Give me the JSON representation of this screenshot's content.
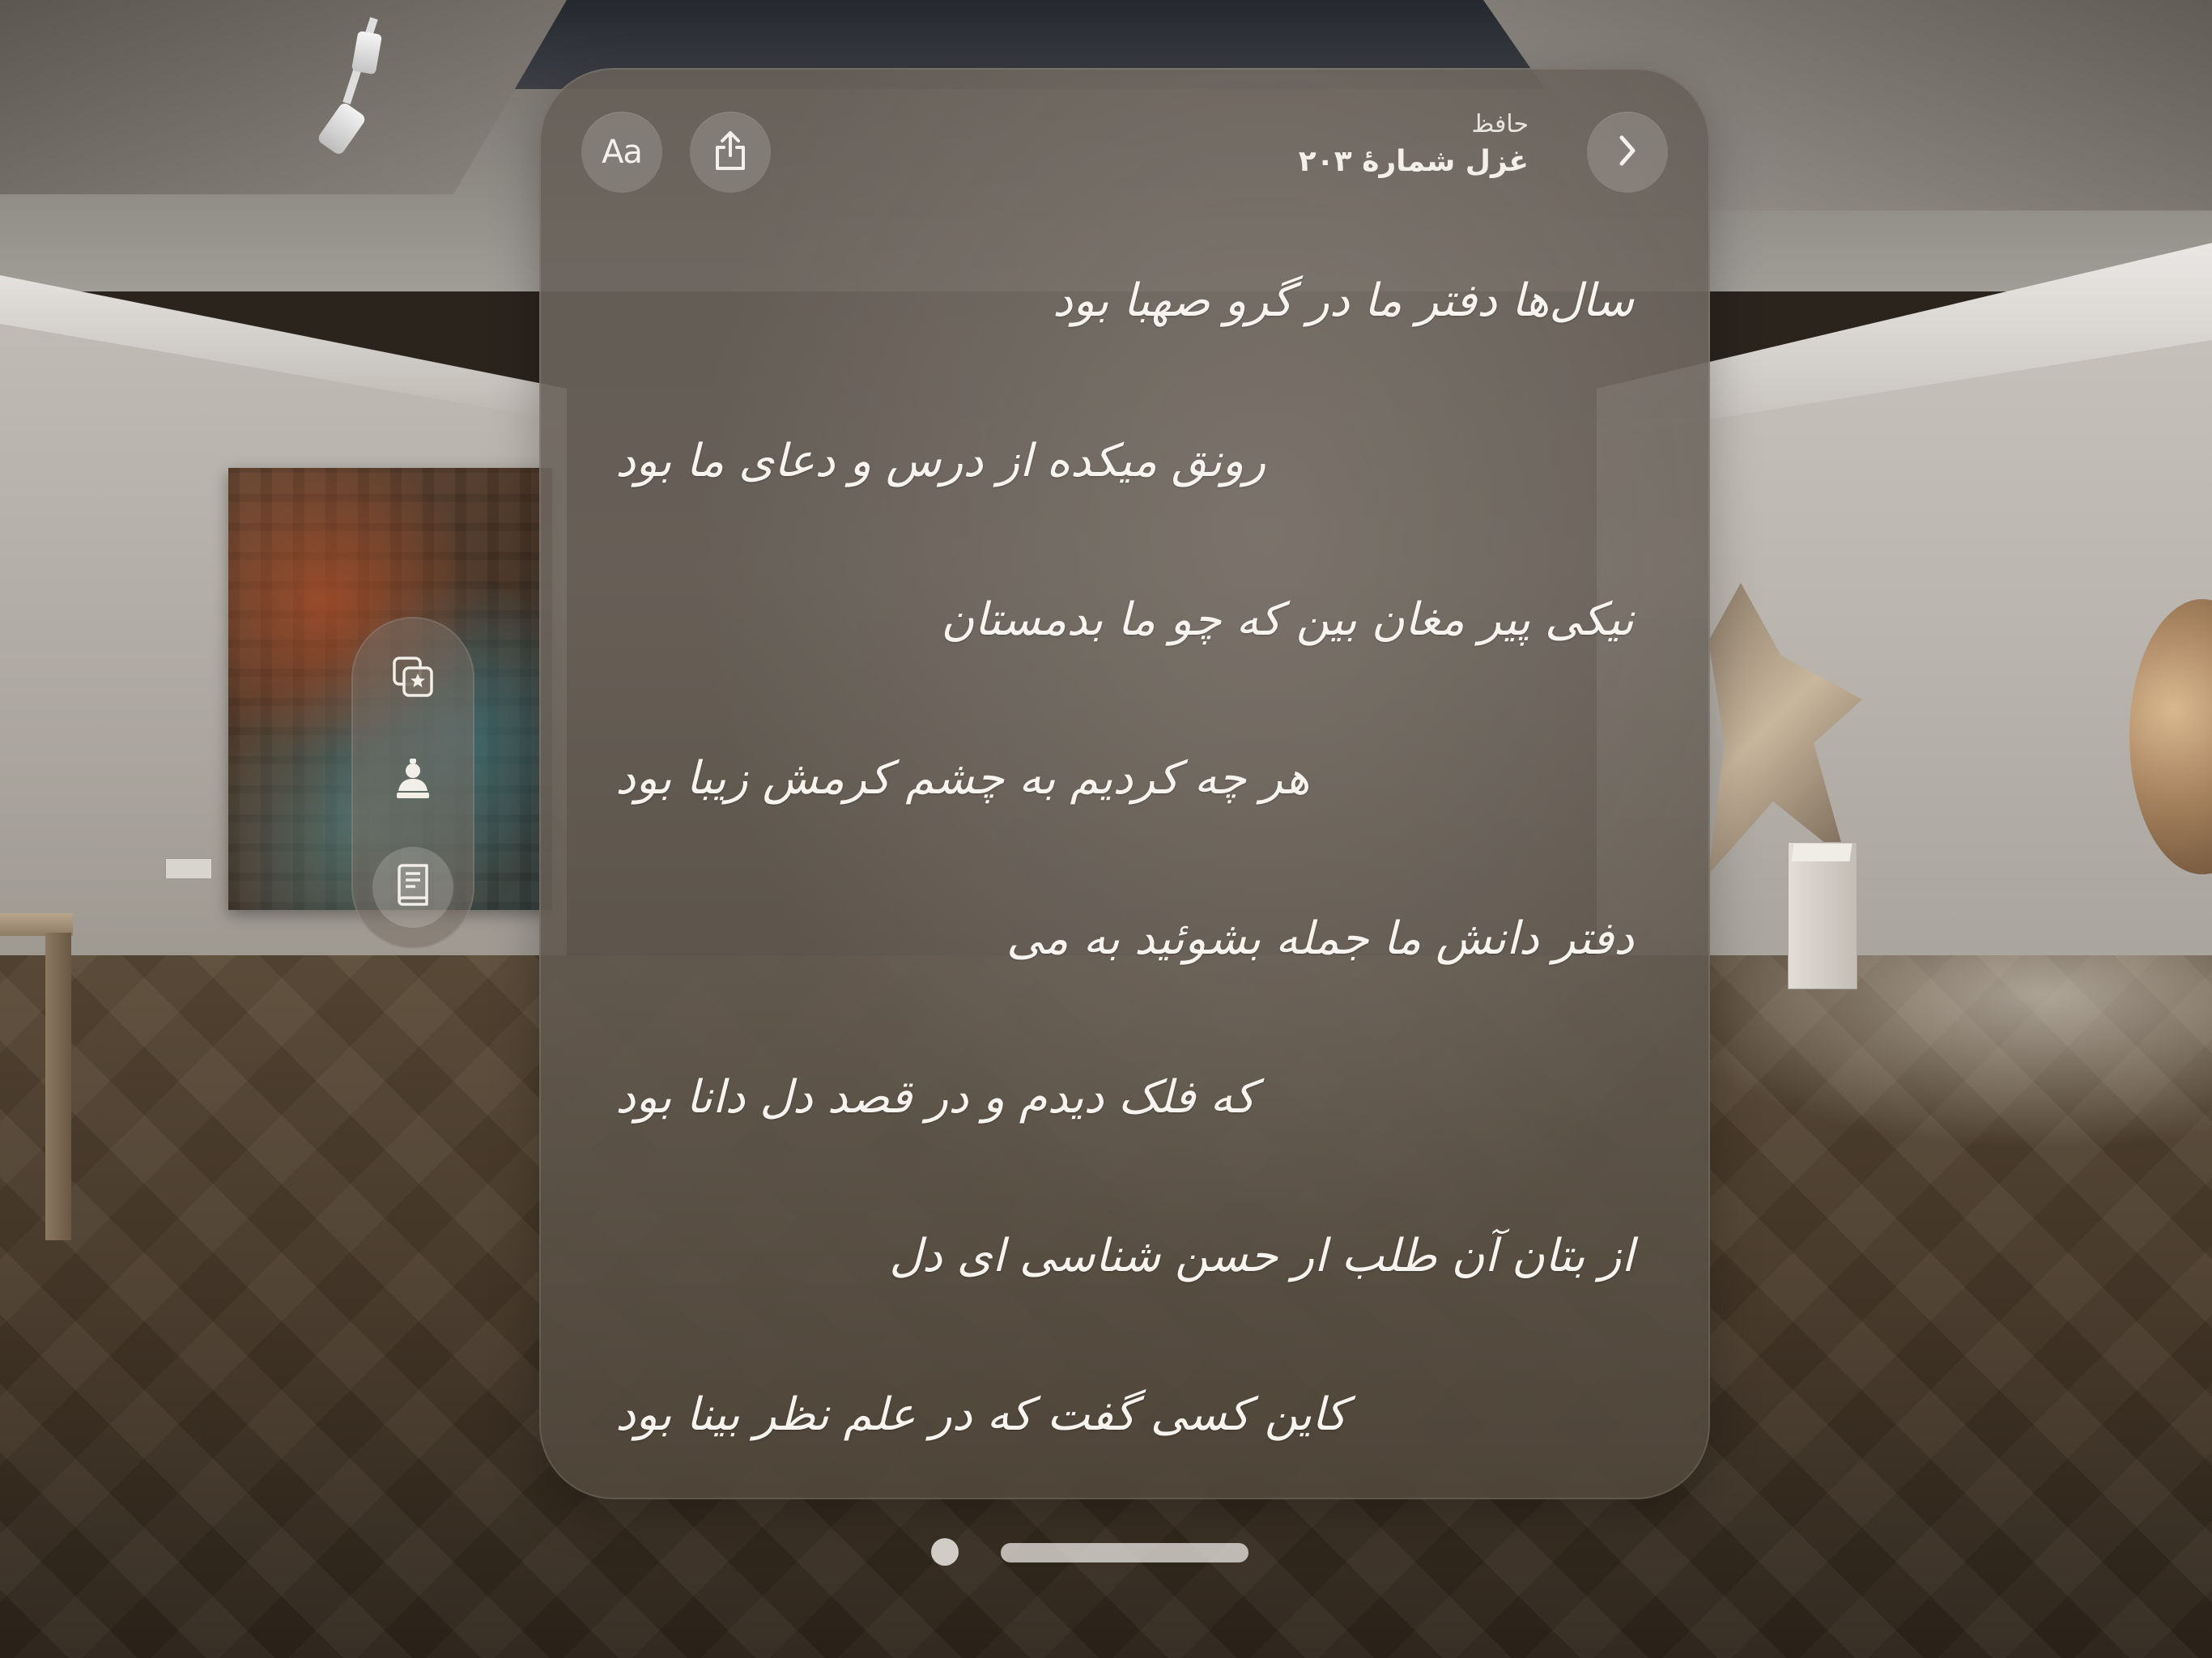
{
  "poem": {
    "author": "حافظ",
    "title": "غزل شمارهٔ ۲۰۳",
    "verses": [
      "سال‌ها دفتر ما در گرو صهبا بود",
      "رونق میکده از درس و دعای ما بود",
      "نیکی پیر مغان بین که چو ما بدمستان",
      "هر چه کردیم به چشم کرمش زیبا بود",
      "دفتر دانش ما جمله بشوئید به می",
      "که فلک دیدم و در قصد دل دانا بود",
      "از بتان آن طلب ار حسن شناسی ای دل",
      "کاین کسی گفت که در علم نظر بینا بود"
    ]
  },
  "toolbar": {
    "font_button_label": "Aa",
    "share_icon": "share-icon",
    "next_icon": "chevron-right-icon"
  },
  "ornament": {
    "items": [
      {
        "icon": "favorites-collection-icon",
        "active": false
      },
      {
        "icon": "poet-icon",
        "active": false
      },
      {
        "icon": "book-icon",
        "active": true
      }
    ]
  },
  "colors": {
    "text": "#f7f4ef",
    "glass": "#6a6158"
  }
}
